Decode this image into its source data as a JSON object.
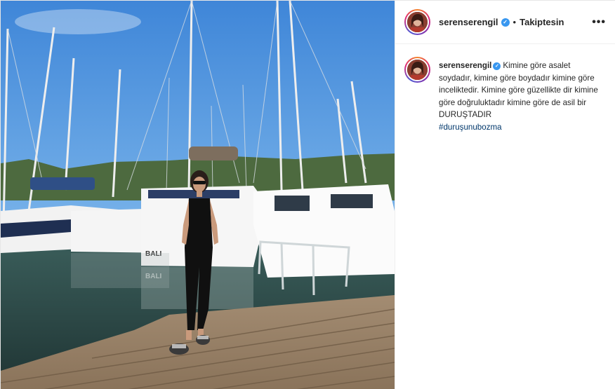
{
  "post": {
    "header": {
      "username": "serenserengil",
      "verified_icon": "verified-badge-icon",
      "separator": "•",
      "follow_status": "Takiptesin",
      "more_icon": "•••"
    },
    "caption": {
      "username": "serenserengil",
      "text": "Kimine göre asalet soydadır, kimine göre boydadır kimine göre inceliktedir. Kimine göre güzellikte dir kimine göre doğruluktadır kimine göre de asil bir DURUŞTADIR",
      "hashtag": "#duruşunubozma"
    },
    "photo": {
      "boat_name": "BALI",
      "boat_name_reflection": "BALI"
    }
  },
  "colors": {
    "verified": "#3897f0",
    "hashtag": "#00376b",
    "text": "#262626"
  }
}
